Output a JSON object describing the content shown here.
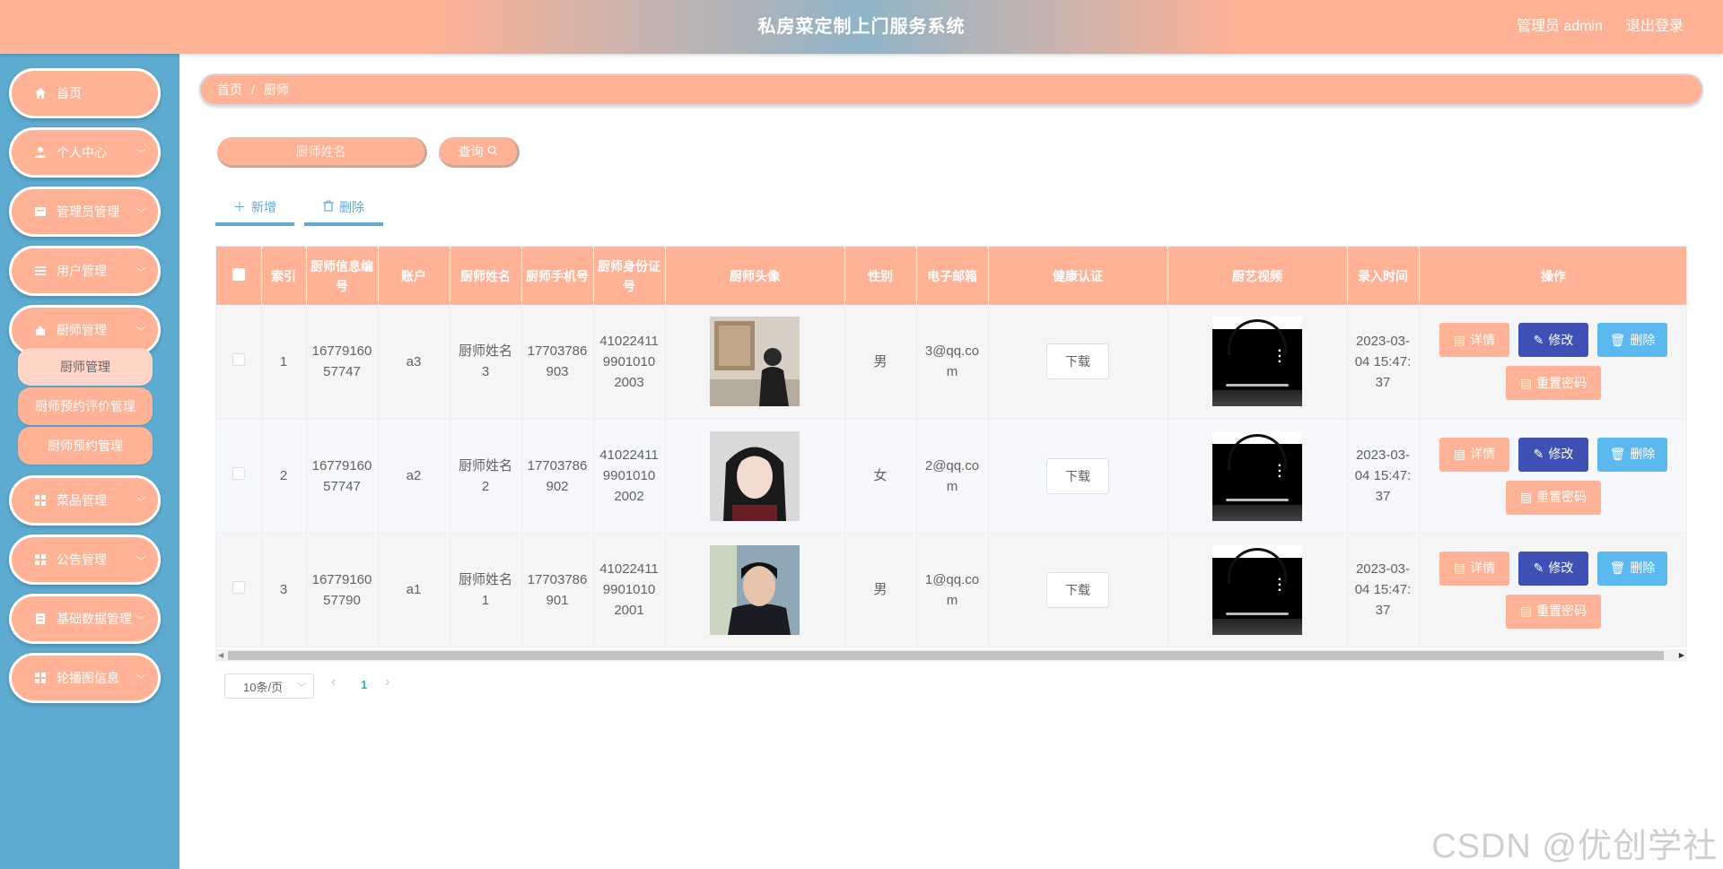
{
  "header": {
    "title": "私房菜定制上门服务系统",
    "user": "管理员 admin",
    "logout": "退出登录"
  },
  "sidebar": {
    "items": [
      {
        "label": "首页",
        "icon": "home-icon"
      },
      {
        "label": "个人中心",
        "icon": "user-icon"
      },
      {
        "label": "管理员管理",
        "icon": "admin-icon"
      },
      {
        "label": "用户管理",
        "icon": "list-icon"
      },
      {
        "label": "厨师管理",
        "icon": "chef-icon"
      },
      {
        "label": "菜品管理",
        "icon": "grid-icon"
      },
      {
        "label": "公告管理",
        "icon": "grid-icon"
      },
      {
        "label": "基础数据管理",
        "icon": "data-icon"
      },
      {
        "label": "轮播图信息",
        "icon": "grid-icon"
      }
    ],
    "submenu": [
      {
        "label": "厨师管理"
      },
      {
        "label": "厨师预约评价管理"
      },
      {
        "label": "厨师预约管理"
      }
    ]
  },
  "breadcrumb": {
    "home": "首页",
    "current": "厨师"
  },
  "search": {
    "placeholder": "厨师姓名",
    "button": "查询"
  },
  "actions": {
    "add": "新增",
    "delete": "删除"
  },
  "table": {
    "headers": [
      "索引",
      "厨师信息编号",
      "账户",
      "厨师姓名",
      "厨师手机号",
      "厨师身份证号",
      "厨师头像",
      "性别",
      "电子邮箱",
      "健康认证",
      "厨艺视频",
      "录入时间",
      "操作"
    ],
    "download_label": "下载",
    "ops": {
      "detail": "详情",
      "edit": "修改",
      "delete": "删除",
      "reset": "重置密码"
    },
    "rows": [
      {
        "index": "1",
        "code": "1677916057747",
        "account": "a3",
        "name": "厨师姓名3",
        "phone": "17703786903",
        "idcard": "410224119901010 2003",
        "gender": "男",
        "email": "3@qq.com",
        "time": "2023-03-04 15:47:37",
        "avatar": "avatar-photo-1"
      },
      {
        "index": "2",
        "code": "1677916057747",
        "account": "a2",
        "name": "厨师姓名2",
        "phone": "17703786902",
        "idcard": "410224119901010 2002",
        "gender": "女",
        "email": "2@qq.com",
        "time": "2023-03-04 15:47:37",
        "avatar": "avatar-photo-2"
      },
      {
        "index": "3",
        "code": "1677916057790",
        "account": "a1",
        "name": "厨师姓名1",
        "phone": "17703786901",
        "idcard": "410224119901010 2001",
        "gender": "男",
        "email": "1@qq.com",
        "time": "2023-03-04 15:47:37",
        "avatar": "avatar-photo-3"
      }
    ]
  },
  "pagination": {
    "page_size": "10条/页",
    "current_page": "1"
  },
  "watermark": "CSDN @优创学社",
  "colors": {
    "primary": "#ffb295",
    "sidebar": "#5dabd0",
    "edit": "#3f51b5",
    "delete": "#5bb9f0"
  }
}
